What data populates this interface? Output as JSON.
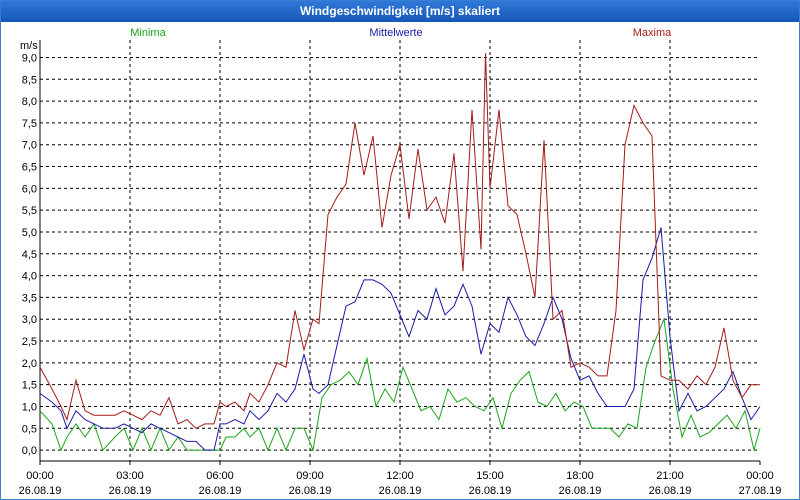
{
  "window": {
    "title": "Windgeschwindigkeit [m/s] skaliert"
  },
  "chart_data": {
    "type": "line",
    "title": "Windgeschwindigkeit [m/s] skaliert",
    "ylabel": "m/s",
    "xlabel": "",
    "ylim": [
      -0.25,
      9.4
    ],
    "xlim_hours": [
      0,
      24
    ],
    "y_ticks": [
      "0,0",
      "0,5",
      "1,0",
      "1,5",
      "2,0",
      "2,5",
      "3,0",
      "3,5",
      "4,0",
      "4,5",
      "5,0",
      "5,5",
      "6,0",
      "6,5",
      "7,0",
      "7,5",
      "8,0",
      "8,5",
      "9,0"
    ],
    "x_ticks": [
      {
        "time": "00:00",
        "date": "26.08.19"
      },
      {
        "time": "03:00",
        "date": "26.08.19"
      },
      {
        "time": "06:00",
        "date": "26.08.19"
      },
      {
        "time": "09:00",
        "date": "26.08.19"
      },
      {
        "time": "12:00",
        "date": "26.08.19"
      },
      {
        "time": "15:00",
        "date": "26.08.19"
      },
      {
        "time": "18:00",
        "date": "26.08.19"
      },
      {
        "time": "21:00",
        "date": "26.08.19"
      },
      {
        "time": "00:00",
        "date": "27.08.19"
      }
    ],
    "grid": true,
    "legend_placement": "top",
    "series": [
      {
        "name": "Minima",
        "color": "#1aa51a",
        "x": [
          0,
          0.4,
          0.7,
          0.9,
          1.2,
          1.5,
          1.8,
          2.1,
          2.5,
          2.8,
          3.1,
          3.4,
          3.7,
          4.0,
          4.3,
          4.6,
          4.9,
          5.2,
          5.5,
          5.8,
          6.0,
          6.2,
          6.5,
          6.8,
          7.0,
          7.3,
          7.6,
          7.9,
          8.2,
          8.5,
          8.8,
          9.1,
          9.4,
          9.7,
          10.0,
          10.3,
          10.6,
          10.9,
          11.2,
          11.5,
          11.8,
          12.1,
          12.4,
          12.7,
          13.0,
          13.3,
          13.6,
          13.9,
          14.2,
          14.5,
          14.8,
          15.1,
          15.4,
          15.7,
          16.0,
          16.3,
          16.6,
          16.9,
          17.2,
          17.5,
          17.8,
          18.1,
          18.4,
          18.7,
          19.0,
          19.3,
          19.6,
          19.9,
          20.2,
          20.5,
          20.8,
          21.1,
          21.4,
          21.7,
          22.0,
          22.3,
          22.6,
          22.9,
          23.2,
          23.5,
          23.8,
          24.0
        ],
        "values": [
          0.9,
          0.6,
          0.0,
          0.3,
          0.6,
          0.3,
          0.6,
          0.0,
          0.3,
          0.5,
          0.0,
          0.5,
          0.0,
          0.5,
          0.0,
          0.3,
          0.0,
          0.0,
          0.0,
          0.0,
          0.0,
          0.3,
          0.3,
          0.5,
          0.3,
          0.5,
          0.0,
          0.5,
          0.0,
          0.5,
          0.5,
          0.0,
          1.2,
          1.5,
          1.6,
          1.8,
          1.5,
          2.1,
          1.0,
          1.4,
          1.1,
          1.9,
          1.4,
          0.9,
          1.0,
          0.7,
          1.4,
          1.1,
          1.2,
          1.0,
          0.9,
          1.2,
          0.5,
          1.3,
          1.6,
          1.8,
          1.1,
          1.0,
          1.3,
          0.9,
          1.1,
          1.0,
          0.5,
          0.5,
          0.5,
          0.3,
          0.6,
          0.5,
          1.9,
          2.5,
          3.0,
          1.4,
          0.3,
          0.8,
          0.3,
          0.4,
          0.6,
          0.8,
          0.5,
          0.9,
          0.0,
          0.5
        ]
      },
      {
        "name": "Mittelwerte",
        "color": "#1a1aa5",
        "x": [
          0,
          0.4,
          0.7,
          0.9,
          1.2,
          1.5,
          1.8,
          2.1,
          2.5,
          2.8,
          3.1,
          3.4,
          3.7,
          4.0,
          4.3,
          4.6,
          4.9,
          5.2,
          5.5,
          5.8,
          6.0,
          6.2,
          6.5,
          6.8,
          7.0,
          7.3,
          7.6,
          7.9,
          8.2,
          8.5,
          8.8,
          9.1,
          9.3,
          9.6,
          9.9,
          10.2,
          10.5,
          10.8,
          11.1,
          11.4,
          11.7,
          12.0,
          12.3,
          12.6,
          12.9,
          13.2,
          13.5,
          13.8,
          14.1,
          14.4,
          14.7,
          15.0,
          15.3,
          15.6,
          15.9,
          16.2,
          16.5,
          16.8,
          17.1,
          17.4,
          17.7,
          18.0,
          18.3,
          18.6,
          18.9,
          19.2,
          19.5,
          19.8,
          20.1,
          20.4,
          20.7,
          21.0,
          21.3,
          21.6,
          21.9,
          22.2,
          22.5,
          22.8,
          23.1,
          23.4,
          23.7,
          24.0
        ],
        "values": [
          1.3,
          1.1,
          0.9,
          0.5,
          0.9,
          0.7,
          0.6,
          0.5,
          0.5,
          0.6,
          0.5,
          0.4,
          0.6,
          0.5,
          0.4,
          0.3,
          0.2,
          0.2,
          0.0,
          0.0,
          0.6,
          0.6,
          0.7,
          0.6,
          0.9,
          0.7,
          0.9,
          1.3,
          1.1,
          1.4,
          2.2,
          1.4,
          1.3,
          1.5,
          2.4,
          3.3,
          3.4,
          3.9,
          3.9,
          3.8,
          3.6,
          3.1,
          2.6,
          3.2,
          3.0,
          3.7,
          3.1,
          3.3,
          3.8,
          3.3,
          2.2,
          2.9,
          2.7,
          3.5,
          3.1,
          2.6,
          2.4,
          2.9,
          3.5,
          3.0,
          2.1,
          1.6,
          1.7,
          1.3,
          1.0,
          1.0,
          1.0,
          1.4,
          3.9,
          4.4,
          5.1,
          2.6,
          0.9,
          1.3,
          0.9,
          1.0,
          1.2,
          1.4,
          1.8,
          1.2,
          0.7,
          1.0
        ]
      },
      {
        "name": "Maxima",
        "color": "#a51a1a",
        "x": [
          0,
          0.4,
          0.7,
          0.9,
          1.2,
          1.5,
          1.8,
          2.1,
          2.5,
          2.8,
          3.1,
          3.4,
          3.7,
          4.0,
          4.3,
          4.6,
          4.9,
          5.2,
          5.5,
          5.8,
          6.0,
          6.2,
          6.5,
          6.8,
          7.0,
          7.3,
          7.6,
          7.9,
          8.2,
          8.5,
          8.8,
          9.1,
          9.3,
          9.6,
          9.9,
          10.2,
          10.5,
          10.8,
          11.1,
          11.4,
          11.7,
          12.0,
          12.3,
          12.6,
          12.9,
          13.2,
          13.5,
          13.8,
          14.1,
          14.4,
          14.7,
          14.85,
          15.0,
          15.3,
          15.6,
          15.9,
          16.2,
          16.5,
          16.8,
          17.1,
          17.4,
          17.7,
          18.0,
          18.3,
          18.6,
          18.9,
          19.2,
          19.5,
          19.8,
          20.1,
          20.4,
          20.7,
          21.0,
          21.3,
          21.6,
          21.9,
          22.2,
          22.5,
          22.8,
          23.1,
          23.4,
          23.7,
          24.0
        ],
        "values": [
          1.9,
          1.4,
          1.0,
          0.7,
          1.6,
          0.9,
          0.8,
          0.8,
          0.8,
          0.9,
          0.8,
          0.7,
          0.9,
          0.8,
          1.2,
          0.6,
          0.7,
          0.5,
          0.6,
          0.6,
          1.1,
          1.0,
          1.1,
          0.9,
          1.3,
          1.1,
          1.5,
          2.0,
          1.9,
          3.2,
          2.3,
          3.0,
          2.9,
          5.4,
          5.8,
          6.1,
          7.5,
          6.3,
          7.2,
          5.1,
          6.3,
          7.0,
          5.3,
          6.9,
          5.5,
          5.8,
          5.2,
          6.8,
          4.1,
          7.8,
          4.6,
          9.1,
          6.0,
          7.8,
          5.6,
          5.4,
          4.5,
          3.5,
          7.1,
          3.0,
          3.2,
          1.9,
          2.0,
          1.9,
          1.7,
          1.7,
          3.2,
          7.0,
          7.9,
          7.5,
          7.2,
          1.7,
          1.6,
          1.6,
          1.4,
          1.7,
          1.5,
          1.9,
          2.8,
          1.6,
          1.2,
          1.5,
          1.5
        ]
      }
    ]
  }
}
